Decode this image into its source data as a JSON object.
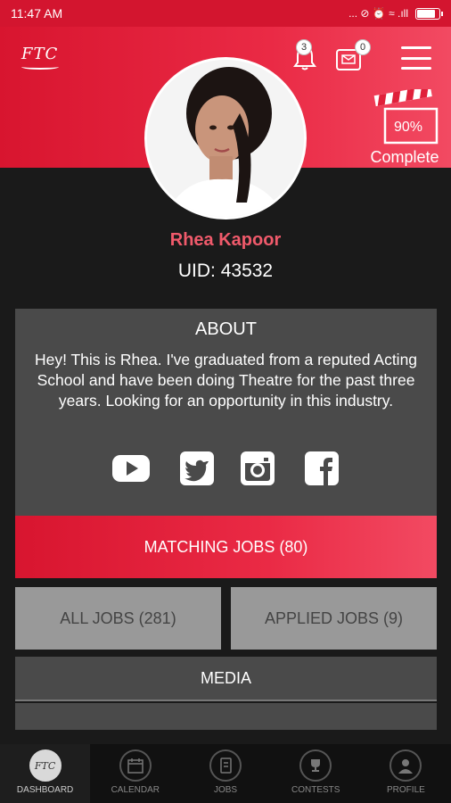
{
  "status_bar": {
    "time": "11:47 AM",
    "icons": "... ⊘ ⏰ ≈ .ıll"
  },
  "header": {
    "logo": "FTC",
    "notifications_count": "3",
    "messages_count": "0",
    "profile_completion": "90%",
    "complete_label": "Complete"
  },
  "profile": {
    "name": "Rhea Kapoor",
    "uid": "UID: 43532"
  },
  "about": {
    "title": "ABOUT",
    "text": "Hey! This is Rhea. I've graduated from a reputed Acting School and have been doing Theatre for the past three years. Looking for an opportunity in this industry.",
    "socials": [
      "youtube-icon",
      "twitter-icon",
      "instagram-icon",
      "facebook-icon"
    ]
  },
  "jobs": {
    "matching": "MATCHING JOBS (80)",
    "all": "ALL JOBS (281)",
    "applied": "APPLIED JOBS (9)"
  },
  "media": {
    "title": "MEDIA"
  },
  "bottom_nav": [
    {
      "label": "DASHBOARD",
      "icon": "ftc-logo-icon",
      "badge": "FTC",
      "active": true
    },
    {
      "label": "CALENDAR",
      "icon": "calendar-icon"
    },
    {
      "label": "JOBS",
      "icon": "jobs-icon"
    },
    {
      "label": "CONTESTS",
      "icon": "trophy-icon"
    },
    {
      "label": "PROFILE",
      "icon": "user-icon"
    }
  ],
  "colors": {
    "accent": "#e0203a",
    "card": "#4a4a4a",
    "button_gray": "#999999",
    "name": "#f05a6b"
  }
}
